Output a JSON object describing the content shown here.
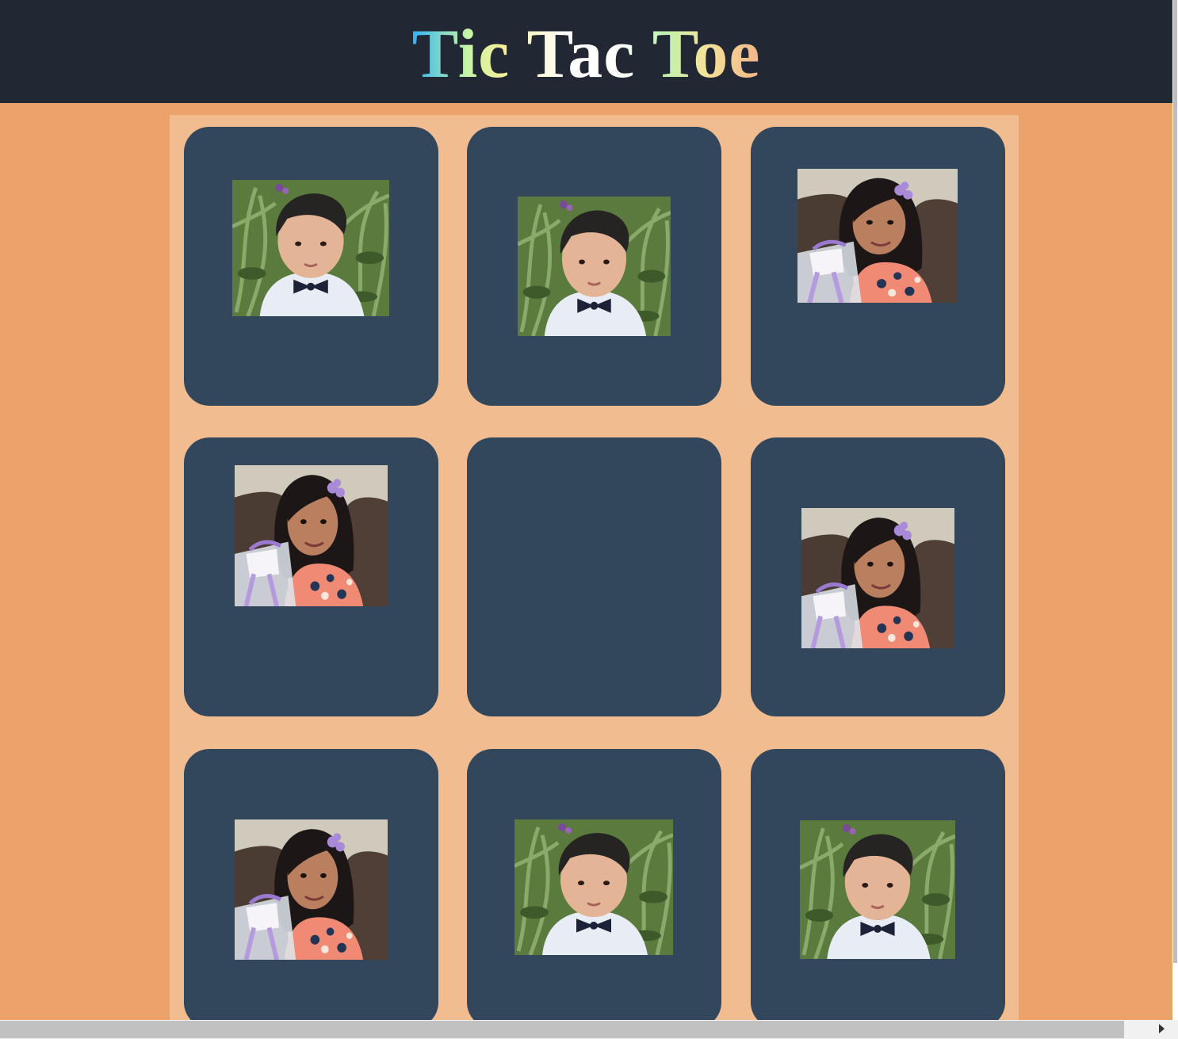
{
  "header": {
    "title": "Tic Tac Toe"
  },
  "board": {
    "cells": [
      {
        "marker": "boy-photo"
      },
      {
        "marker": "boy-photo"
      },
      {
        "marker": "girl-photo"
      },
      {
        "marker": "girl-photo"
      },
      {
        "marker": "empty"
      },
      {
        "marker": "girl-photo"
      },
      {
        "marker": "girl-photo"
      },
      {
        "marker": "boy-photo"
      },
      {
        "marker": "boy-photo"
      }
    ]
  },
  "colors": {
    "page_background": "#eda26a",
    "header_background": "#222833",
    "board_background": "#f2bc91",
    "cell_background": "#33475c"
  }
}
